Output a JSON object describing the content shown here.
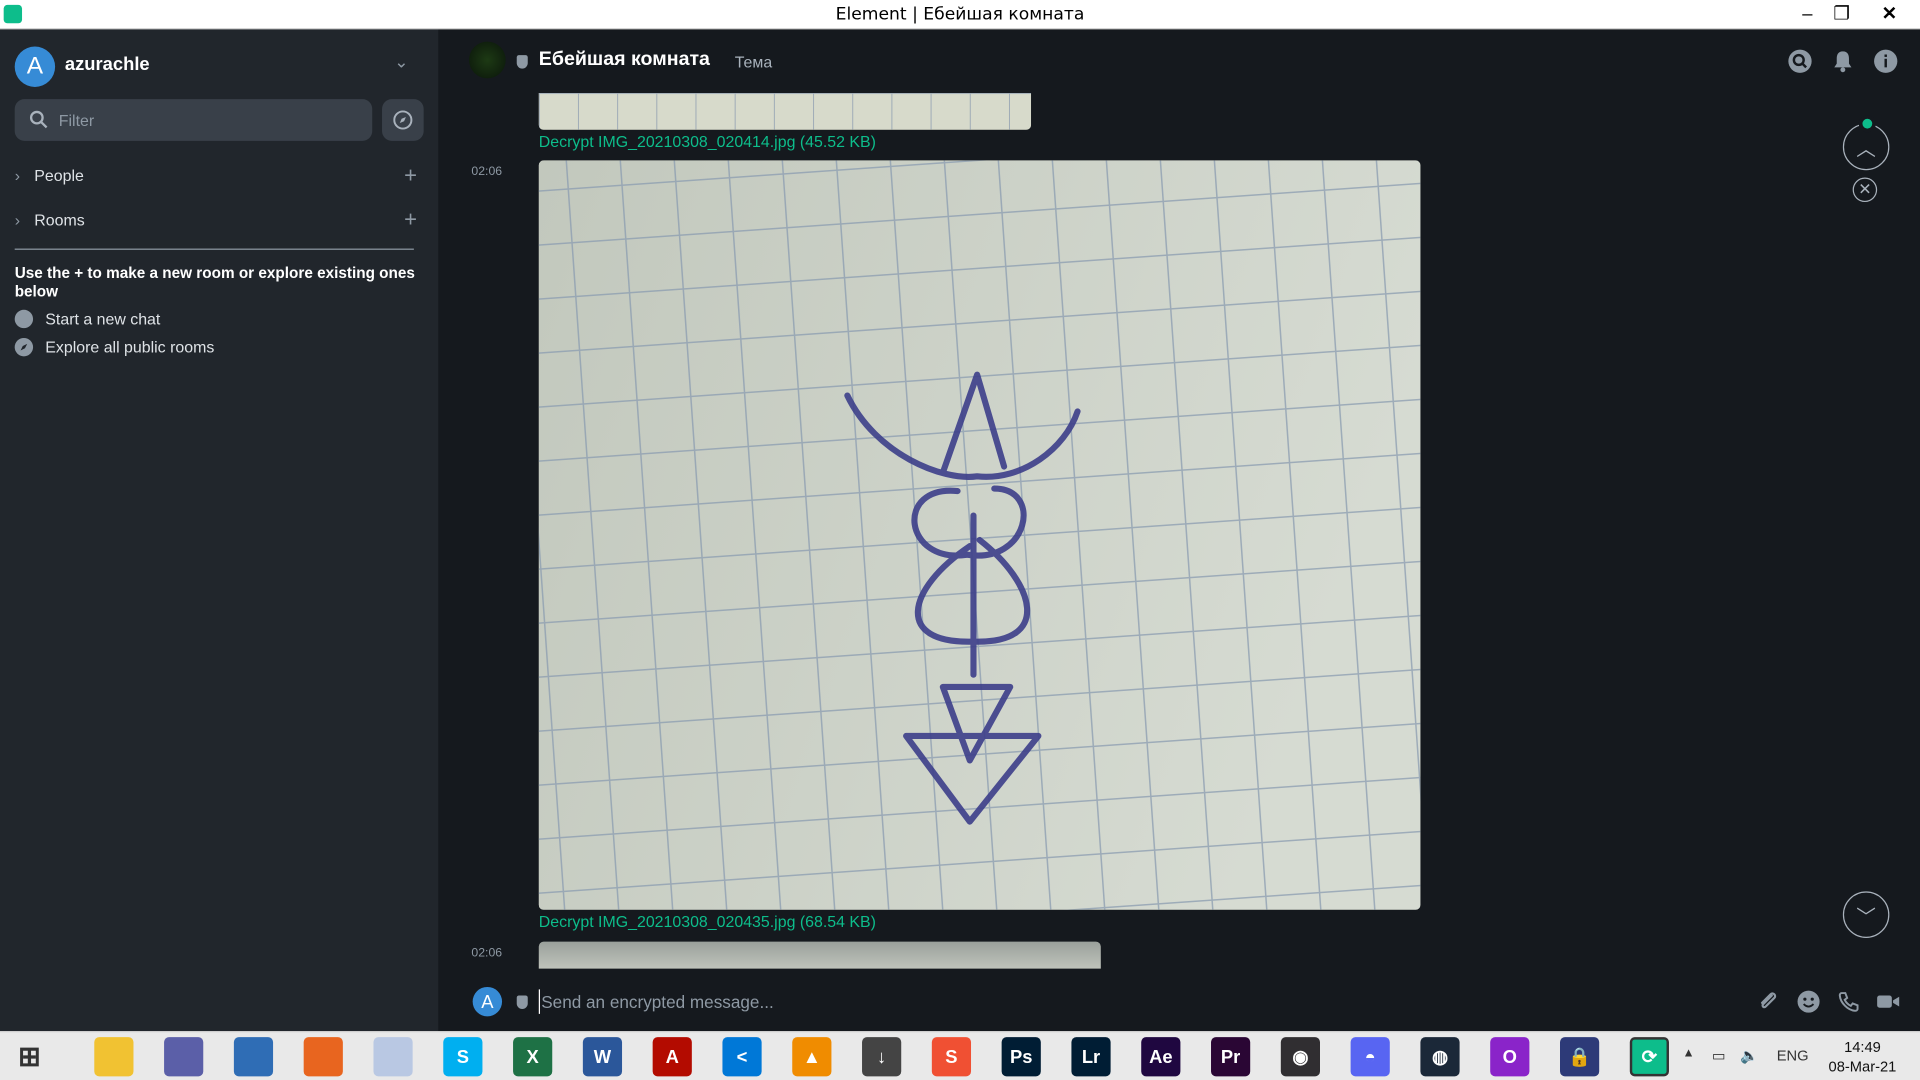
{
  "window": {
    "title": "Element | Ебейшая комната"
  },
  "sidebar": {
    "avatar_letter": "A",
    "username": "azurachle",
    "filter_placeholder": "Filter",
    "sections": [
      {
        "label": "People"
      },
      {
        "label": "Rooms"
      }
    ],
    "hint": "Use the + to make a new room or explore existing ones below",
    "links": [
      {
        "label": "Start a new chat",
        "icon": "chat-bubble-icon"
      },
      {
        "label": "Explore all public rooms",
        "icon": "compass-icon"
      }
    ]
  },
  "room": {
    "name": "Ебейшая комната",
    "topic": "Тема"
  },
  "timeline": {
    "messages": [
      {
        "time": "",
        "caption": "Decrypt IMG_20210308_020414.jpg (45.52 KB)"
      },
      {
        "time": "02:06",
        "caption": "Decrypt IMG_20210308_020435.jpg (68.54 KB)"
      },
      {
        "time": "02:06",
        "caption": ""
      }
    ]
  },
  "composer": {
    "avatar_letter": "A",
    "placeholder": "Send an encrypted message..."
  },
  "taskbar": {
    "apps": [
      {
        "name": "windows-start",
        "color": "#ffffff"
      },
      {
        "name": "file-explorer",
        "color": "#f1c232"
      },
      {
        "name": "qbittorrent",
        "color": "#5b5fa8"
      },
      {
        "name": "browser-globe",
        "color": "#2f6db5"
      },
      {
        "name": "firefox",
        "color": "#e8651f"
      },
      {
        "name": "cloud-app",
        "color": "#b9c8e3"
      },
      {
        "name": "skype",
        "color": "#00aff0",
        "label": "S"
      },
      {
        "name": "excel",
        "color": "#1e7145",
        "label": "X"
      },
      {
        "name": "word",
        "color": "#2b579a",
        "label": "W"
      },
      {
        "name": "acrobat",
        "color": "#b30b00",
        "label": "A"
      },
      {
        "name": "vscode",
        "color": "#0078d7",
        "label": "<"
      },
      {
        "name": "vlc",
        "color": "#f08c00",
        "label": "▲"
      },
      {
        "name": "downloader",
        "color": "#444444",
        "label": "↓"
      },
      {
        "name": "sublime",
        "color": "#f05033",
        "label": "S"
      },
      {
        "name": "photoshop",
        "color": "#001d34",
        "label": "Ps"
      },
      {
        "name": "lightroom",
        "color": "#001d34",
        "label": "Lr"
      },
      {
        "name": "after-effects",
        "color": "#1f0740",
        "label": "Ae"
      },
      {
        "name": "premiere",
        "color": "#2a0634",
        "label": "Pr"
      },
      {
        "name": "obs",
        "color": "#302e31",
        "label": "◉"
      },
      {
        "name": "discord",
        "color": "#5865f2",
        "label": "◓"
      },
      {
        "name": "steam",
        "color": "#1b2838",
        "label": "◍"
      },
      {
        "name": "opera-gx",
        "color": "#8a24c9",
        "label": "O"
      },
      {
        "name": "vpn-lock",
        "color": "#2d3a78",
        "label": "🔒"
      },
      {
        "name": "element",
        "color": "#0dbd8b",
        "label": "⟳"
      }
    ],
    "language": "ENG",
    "time": "14:49",
    "date": "08-Mar-21"
  }
}
